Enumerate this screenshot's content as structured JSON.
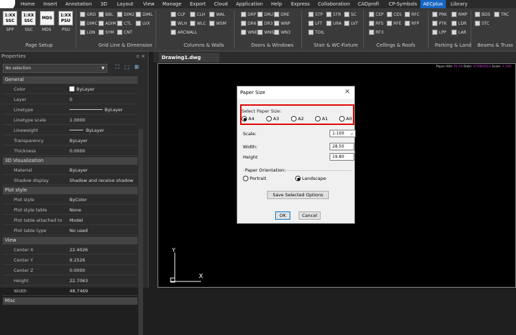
{
  "menubar": {
    "items": [
      "Home",
      "Insert",
      "Annotation",
      "3D",
      "Layout",
      "View",
      "Manage",
      "Export",
      "Cloud",
      "Application",
      "Help",
      "Express",
      "Collaboration",
      "CADprofi",
      "CP-Symbols",
      "AECplus",
      "Library"
    ],
    "active": "AECplus"
  },
  "ribbon": {
    "big_buttons": [
      {
        "label": "SPP",
        "icon_text": "1:XX\nSSC"
      },
      {
        "label": "SSC",
        "icon_text": "1:XX\nSSC"
      },
      {
        "label": "MDS",
        "icon_text": "MDS"
      },
      {
        "label": "PSU",
        "icon_text": "1:XX\nPSU"
      }
    ],
    "group_labels": [
      "Page Setup",
      "Grid Line & Dimension",
      "Columns & Walls",
      "Doors & Windows",
      "Stair & WC-Fixture",
      "Cellings & Roofs",
      "Parking & Land",
      "Beams & Truss"
    ],
    "tools": {
      "grid": [
        "GRD",
        "BBL",
        "DIM2",
        "DIML",
        "DIMC",
        "ADIM",
        "CTL",
        "LVX",
        "LDN",
        "SYM",
        "CNT"
      ],
      "columns": [
        "CLP",
        "CLH",
        "WAL",
        "WLH",
        "WLC",
        "WSM",
        "ARCWALL"
      ],
      "doors": [
        "DRP",
        "DRU",
        "DRE",
        "DR6",
        "DR3",
        "WNP",
        "WNE",
        "WNS",
        "WN3"
      ],
      "stair": [
        "STP",
        "STR",
        "SC",
        "LFT",
        "URA",
        "LVT",
        "TOIL"
      ],
      "ceilings": [
        "CEP",
        "CES",
        "RFC",
        "RFS",
        "RFE",
        "RFP",
        "RF3"
      ],
      "parking": [
        "PRK",
        "RMP",
        "PTK",
        "LDR",
        "LPP",
        "LAR"
      ],
      "beams": [
        "BDS",
        "TRC",
        "STC"
      ]
    }
  },
  "properties": {
    "title": "Properties",
    "title_buttons": "▫ ×",
    "selection": "No selection",
    "sections": [
      {
        "name": "General",
        "rows": [
          {
            "label": "Color",
            "value": "ByLayer"
          },
          {
            "label": "Layer",
            "value": "0"
          },
          {
            "label": "Linetype",
            "value": "ByLayer"
          },
          {
            "label": "Linetype scale",
            "value": "1.0000"
          },
          {
            "label": "Lineweight",
            "value": "ByLayer"
          },
          {
            "label": "Transparency",
            "value": "ByLayer"
          },
          {
            "label": "Thickness",
            "value": "0.0000"
          }
        ]
      },
      {
        "name": "3D Visualization",
        "rows": [
          {
            "label": "Material",
            "value": "ByLayer"
          },
          {
            "label": "Shadow display",
            "value": "Shadow and receive shadow"
          }
        ]
      },
      {
        "name": "Plot style",
        "rows": [
          {
            "label": "Plot style",
            "value": "ByColor"
          },
          {
            "label": "Plot style table",
            "value": "None"
          },
          {
            "label": "Plot table attached to",
            "value": "Model"
          },
          {
            "label": "Plot table type",
            "value": "No used"
          }
        ]
      },
      {
        "name": "View",
        "rows": [
          {
            "label": "Center X",
            "value": "22.4026"
          },
          {
            "label": "Center Y",
            "value": "9.2526"
          },
          {
            "label": "Center Z",
            "value": "0.0000"
          },
          {
            "label": "Height",
            "value": "22.7063"
          },
          {
            "label": "Width",
            "value": "48.7469"
          }
        ]
      },
      {
        "name": "Misc",
        "rows": []
      }
    ]
  },
  "document": {
    "tab": "Drawing1.dwg",
    "paper_title": {
      "l1": "Paper title:",
      "v1": "PL-A4",
      "l2": "Date:",
      "v2": "07/06/2023",
      "l3": "Scale:",
      "v3": "1:100"
    }
  },
  "dialog": {
    "title": "Paper Size",
    "select_label": "Select Paper Size:",
    "sizes": [
      {
        "label": "A4",
        "checked": true
      },
      {
        "label": "A3",
        "checked": false
      },
      {
        "label": "A2",
        "checked": false
      },
      {
        "label": "A1",
        "checked": false
      },
      {
        "label": "A0",
        "checked": false
      }
    ],
    "scale_label": "Scale:",
    "scale_value": "1:100",
    "width_label": "Width:",
    "width_value": "28.50",
    "height_label": "Height",
    "height_value": "19.80",
    "orientation_label": "Paper Orientation:",
    "portrait_label": "Portrait",
    "portrait_checked": false,
    "landscape_label": "Landscape",
    "landscape_checked": true,
    "save_label": "Save Selected Options",
    "ok_label": "OK",
    "cancel_label": "Cancel"
  },
  "ucs": {
    "x": "X",
    "y": "Y"
  }
}
